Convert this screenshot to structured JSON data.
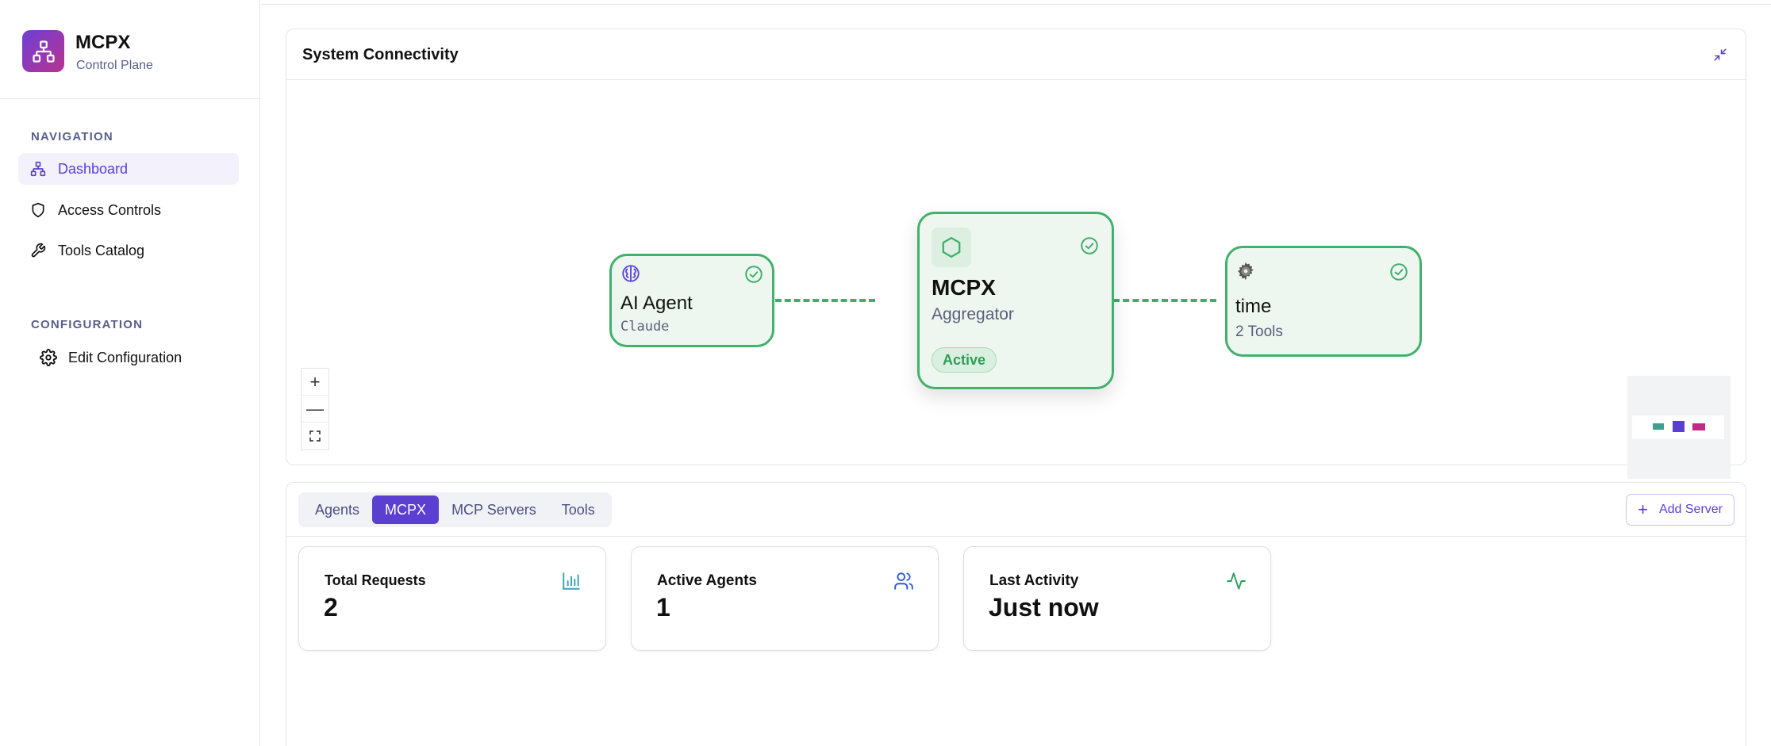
{
  "brand": {
    "title": "MCPX",
    "subtitle": "Control Plane"
  },
  "sidebar": {
    "navigation_label": "NAVIGATION",
    "navigation": [
      {
        "label": "Dashboard",
        "icon": "network-icon",
        "active": true
      },
      {
        "label": "Access Controls",
        "icon": "shield-icon"
      },
      {
        "label": "Tools Catalog",
        "icon": "wrench-icon"
      }
    ],
    "configuration_label": "CONFIGURATION",
    "configuration": [
      {
        "label": "Edit Configuration",
        "icon": "gear-icon"
      }
    ]
  },
  "connectivity": {
    "title": "System Connectivity",
    "nodes": {
      "agent": {
        "title": "AI Agent",
        "subtitle": "Claude",
        "icon": "brain-icon",
        "status": "connected"
      },
      "mcpx": {
        "title": "MCPX",
        "subtitle": "Aggregator",
        "badge": "Active",
        "icon": "hexagon-icon",
        "status": "connected"
      },
      "server": {
        "title": "time",
        "subtitle": "2 Tools",
        "icon": "cog-icon",
        "status": "connected"
      }
    },
    "zoom_controls": {
      "zoom_in": "+",
      "zoom_out": "—"
    }
  },
  "tabs": {
    "items": [
      "Agents",
      "MCPX",
      "MCP Servers",
      "Tools"
    ],
    "active": "MCPX",
    "add_server_label": "Add Server"
  },
  "stats": [
    {
      "label": "Total Requests",
      "value": "2",
      "icon": "bar-chart-icon",
      "icon_color": "#38a3b8"
    },
    {
      "label": "Active Agents",
      "value": "1",
      "icon": "users-icon",
      "icon_color": "#2f5fd0"
    },
    {
      "label": "Last Activity",
      "value": "Just now",
      "icon": "activity-icon",
      "icon_color": "#2e9e5b"
    }
  ],
  "colors": {
    "accent": "#5b3fd0",
    "node_border": "#43b06c",
    "node_fill": "#edf7ef"
  }
}
